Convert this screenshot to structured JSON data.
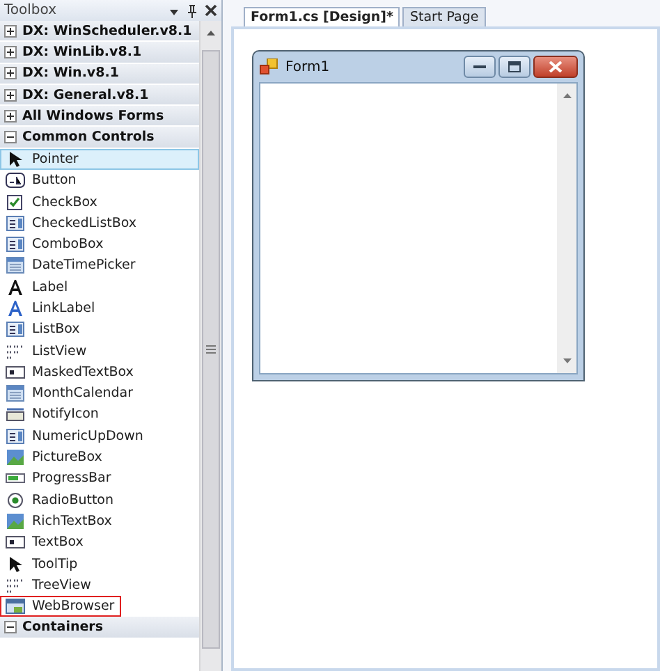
{
  "toolbox": {
    "title": "Toolbox",
    "groups": [
      {
        "label": "DX: WinScheduler.v8.1",
        "expanded": false
      },
      {
        "label": "DX: WinLib.v8.1",
        "expanded": false
      },
      {
        "label": "DX: Win.v8.1",
        "expanded": false
      },
      {
        "label": "DX: General.v8.1",
        "expanded": false
      },
      {
        "label": "All Windows Forms",
        "expanded": false
      },
      {
        "label": "Common Controls",
        "expanded": true,
        "items": [
          {
            "label": "Pointer",
            "kind": "pointer",
            "selected": true,
            "outlined": false
          },
          {
            "label": "Button",
            "kind": "button",
            "selected": false,
            "outlined": false
          },
          {
            "label": "CheckBox",
            "kind": "checkbox",
            "selected": false,
            "outlined": false
          },
          {
            "label": "CheckedListBox",
            "kind": "list",
            "selected": false,
            "outlined": false
          },
          {
            "label": "ComboBox",
            "kind": "combo",
            "selected": false,
            "outlined": false
          },
          {
            "label": "DateTimePicker",
            "kind": "calendar",
            "selected": false,
            "outlined": false
          },
          {
            "label": "Label",
            "kind": "label",
            "selected": false,
            "outlined": false
          },
          {
            "label": "LinkLabel",
            "kind": "linklabel",
            "selected": false,
            "outlined": false
          },
          {
            "label": "ListBox",
            "kind": "combo",
            "selected": false,
            "outlined": false
          },
          {
            "label": "ListView",
            "kind": "grid",
            "selected": false,
            "outlined": false
          },
          {
            "label": "MaskedTextBox",
            "kind": "textbox",
            "selected": false,
            "outlined": false
          },
          {
            "label": "MonthCalendar",
            "kind": "calendar",
            "selected": false,
            "outlined": false
          },
          {
            "label": "NotifyIcon",
            "kind": "tray",
            "selected": false,
            "outlined": false
          },
          {
            "label": "NumericUpDown",
            "kind": "list",
            "selected": false,
            "outlined": false
          },
          {
            "label": "PictureBox",
            "kind": "picturebox",
            "selected": false,
            "outlined": false
          },
          {
            "label": "ProgressBar",
            "kind": "progress",
            "selected": false,
            "outlined": false
          },
          {
            "label": "RadioButton",
            "kind": "radio",
            "selected": false,
            "outlined": false
          },
          {
            "label": "RichTextBox",
            "kind": "picturebox",
            "selected": false,
            "outlined": false
          },
          {
            "label": "TextBox",
            "kind": "textbox",
            "selected": false,
            "outlined": false
          },
          {
            "label": "ToolTip",
            "kind": "pointer",
            "selected": false,
            "outlined": false
          },
          {
            "label": "TreeView",
            "kind": "grid",
            "selected": false,
            "outlined": false
          },
          {
            "label": "WebBrowser",
            "kind": "window",
            "selected": false,
            "outlined": true
          }
        ]
      },
      {
        "label": "Containers",
        "expanded": true
      }
    ]
  },
  "tabs": [
    {
      "label": "Form1.cs [Design]*",
      "selected": true
    },
    {
      "label": "Start Page",
      "selected": false
    }
  ],
  "form": {
    "title": "Form1"
  }
}
